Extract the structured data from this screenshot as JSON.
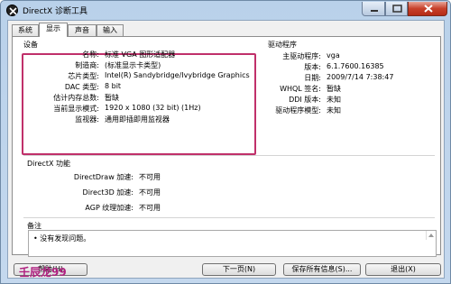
{
  "window": {
    "title": "DirectX 诊断工具"
  },
  "tabs": [
    "系统",
    "显示",
    "声音",
    "输入"
  ],
  "device": {
    "group_title": "设备",
    "rows": [
      {
        "label": "名称:",
        "value": "标准 VGA 图形适配器"
      },
      {
        "label": "制造商:",
        "value": "(标准显示卡类型)"
      },
      {
        "label": "芯片类型:",
        "value": "Intel(R) Sandybridge/Ivybridge Graphics"
      },
      {
        "label": "DAC 类型:",
        "value": "8 bit"
      },
      {
        "label": "估计内存总数:",
        "value": "暂缺"
      },
      {
        "label": "当前显示模式:",
        "value": "1920 x 1080 (32 bit) (1Hz)"
      },
      {
        "label": "监视器:",
        "value": "通用即插即用监视器"
      }
    ]
  },
  "driver": {
    "group_title": "驱动程序",
    "rows": [
      {
        "label": "主驱动程序:",
        "value": "vga"
      },
      {
        "label": "版本:",
        "value": "6.1.7600.16385"
      },
      {
        "label": "日期:",
        "value": "2009/7/14 7:38:47"
      },
      {
        "label": "WHQL 签名:",
        "value": "暂缺"
      },
      {
        "label": "DDI 版本:",
        "value": "未知"
      },
      {
        "label": "驱动程序模型:",
        "value": "未知"
      }
    ]
  },
  "directx": {
    "group_title": "DirectX 功能",
    "rows": [
      {
        "label": "DirectDraw 加速:",
        "value": "不可用"
      },
      {
        "label": "Direct3D 加速:",
        "value": "不可用"
      },
      {
        "label": "AGP 纹理加速:",
        "value": "不可用"
      }
    ]
  },
  "notes": {
    "group_title": "备注",
    "items": [
      "没有发现问题。"
    ]
  },
  "buttons": {
    "help": "帮助(H)",
    "next": "下一页(N)",
    "save": "保存所有信息(S)...",
    "exit": "退出(X)"
  },
  "watermark": "壬辰龙99",
  "colors": {
    "highlight_border": "#c0306a",
    "close_button": "#c7402a"
  }
}
